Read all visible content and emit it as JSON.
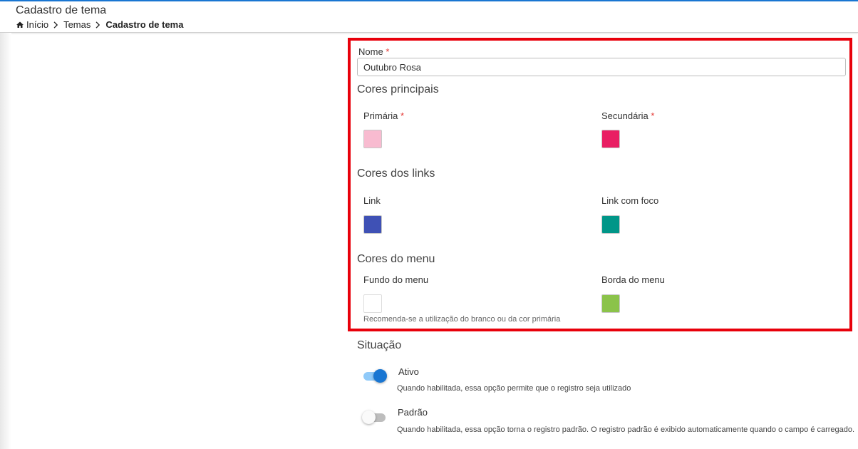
{
  "header": {
    "title": "Cadastro de tema",
    "breadcrumb": {
      "home": "Início",
      "themes": "Temas",
      "current": "Cadastro de tema"
    }
  },
  "form": {
    "name_label": "Nome",
    "required_mark": "*",
    "name_value": "Outubro Rosa",
    "main_colors": {
      "title": "Cores principais",
      "primary_label": "Primária",
      "primary_color": "#f8bbd0",
      "secondary_label": "Secundária",
      "secondary_color": "#e91e63"
    },
    "link_colors": {
      "title": "Cores dos links",
      "link_label": "Link",
      "link_color": "#3f51b5",
      "focus_label": "Link com foco",
      "focus_color": "#009688"
    },
    "menu_colors": {
      "title": "Cores do menu",
      "background_label": "Fundo do menu",
      "background_color": "#ffffff",
      "background_hint": "Recomenda-se a utilização do branco ou da cor primária",
      "border_label": "Borda do menu",
      "border_color": "#8bc34a"
    },
    "status": {
      "title": "Situação",
      "active": {
        "label": "Ativo",
        "enabled": true,
        "description": "Quando habilitada, essa opção permite que o registro seja utilizado"
      },
      "default": {
        "label": "Padrão",
        "enabled": false,
        "description": "Quando habilitada, essa opção torna o registro padrão. O registro padrão é exibido automaticamente quando o campo é carregado."
      }
    }
  },
  "colors": {
    "accent": "#1976d2",
    "highlight_border": "#e8000b",
    "required": "#e53935"
  }
}
